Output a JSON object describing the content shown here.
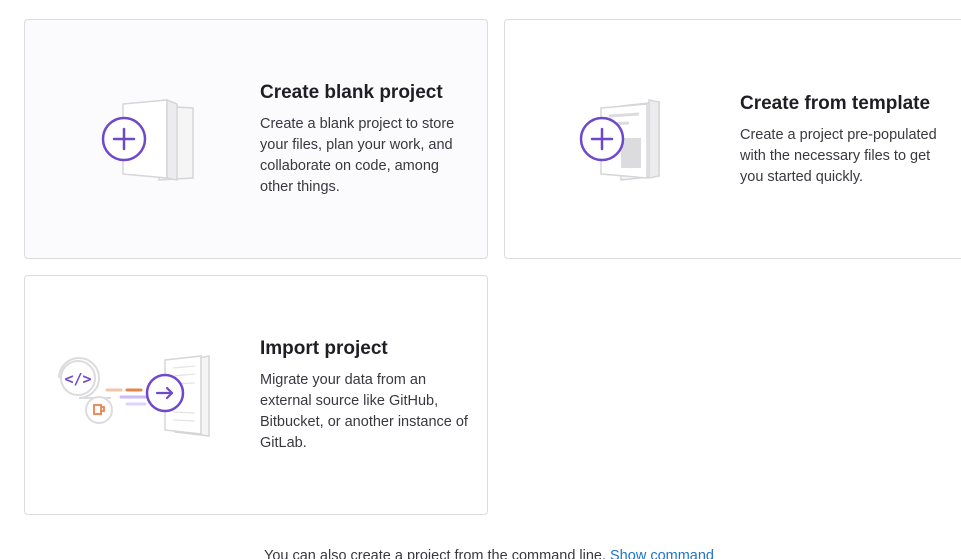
{
  "cards": {
    "blank": {
      "title": "Create blank project",
      "description": "Create a blank project to store your files, plan your work, and collaborate on code, among other things."
    },
    "template": {
      "title": "Create from template",
      "description": "Create a project pre-populated with the necessary files to get you started quickly."
    },
    "import": {
      "title": "Import project",
      "description": "Migrate your data from an external source like GitHub, Bitbucket, or another instance of GitLab."
    }
  },
  "footer": {
    "text": "You can also create a project from the command line.",
    "link_label": "Show command"
  },
  "colors": {
    "accent_purple": "#6e49cb",
    "link_blue": "#1f75cb",
    "card_border": "#dcdcde",
    "orange": "#e9834b"
  },
  "icons": {
    "blank": "plus-document-icon",
    "template": "template-document-icon",
    "import": "import-arrow-icon"
  }
}
